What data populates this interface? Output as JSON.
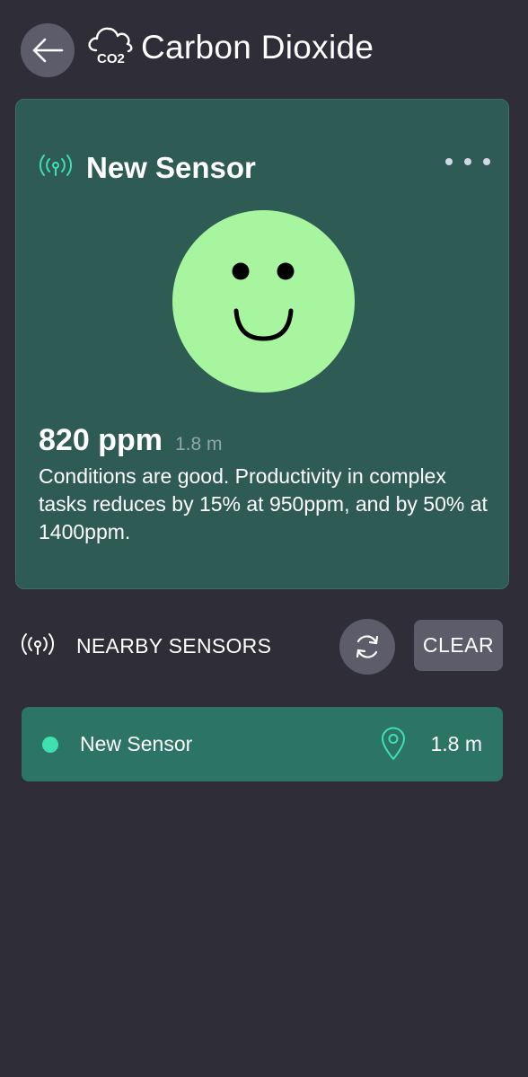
{
  "header": {
    "title": "Carbon Dioxide",
    "back_icon": "arrow-left-icon",
    "co2_icon": "co2-cloud-icon",
    "co2_icon_text": "CO2"
  },
  "sensor_card": {
    "name": "New Sensor",
    "signal_icon": "signal-icon",
    "more_icon": "more-horizontal-icon",
    "status_face": "smiley-face-icon",
    "reading": "820 ppm",
    "distance": "1.8 m",
    "description": "Conditions are good. Productivity in complex tasks reduces by 15% at 950ppm, and by 50% at 1400ppm."
  },
  "nearby": {
    "label": "NEARBY SENSORS",
    "signal_icon": "signal-icon",
    "refresh_icon": "refresh-icon",
    "clear_label": "CLEAR",
    "sensors": [
      {
        "name": "New Sensor",
        "distance": "1.8 m",
        "location_icon": "location-pin-icon"
      }
    ]
  },
  "colors": {
    "background": "#2f2e38",
    "card": "#2f5b55",
    "row": "#2c7463",
    "accent": "#3ee0b0",
    "face": "#a7f59e",
    "button": "#5d5c6a"
  }
}
